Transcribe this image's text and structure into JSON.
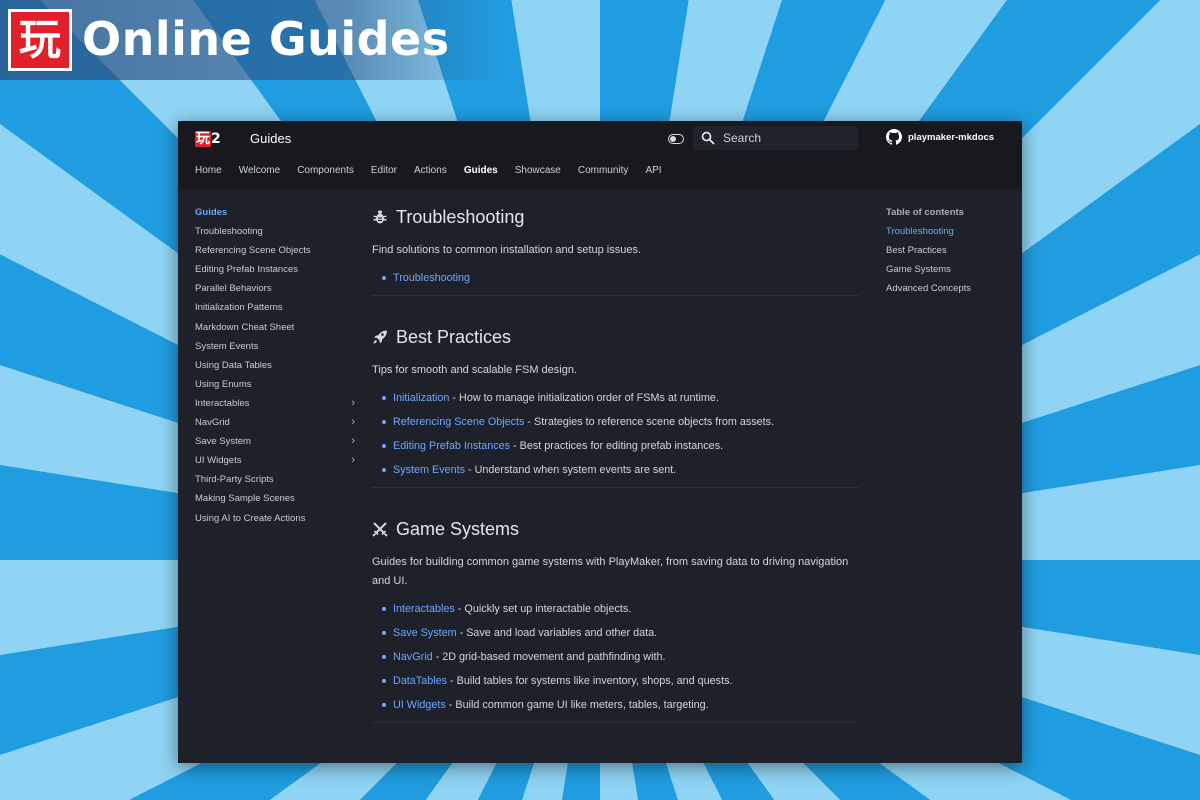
{
  "banner": {
    "logo_char": "玩",
    "title": "Online Guides"
  },
  "header": {
    "logo_char": "玩",
    "logo_num": "2",
    "title": "Guides",
    "search_placeholder": "Search",
    "repo": "playmaker-mkdocs"
  },
  "nav": {
    "items": [
      "Home",
      "Welcome",
      "Components",
      "Editor",
      "Actions",
      "Guides",
      "Showcase",
      "Community",
      "API"
    ],
    "active": "Guides"
  },
  "sidebar": {
    "items": [
      {
        "label": "Guides",
        "active": true,
        "expandable": false
      },
      {
        "label": "Troubleshooting",
        "expandable": false
      },
      {
        "label": "Referencing Scene Objects",
        "expandable": false
      },
      {
        "label": "Editing Prefab Instances",
        "expandable": false
      },
      {
        "label": "Parallel Behaviors",
        "expandable": false
      },
      {
        "label": "Initialization Patterns",
        "expandable": false
      },
      {
        "label": "Markdown Cheat Sheet",
        "expandable": false
      },
      {
        "label": "System Events",
        "expandable": false
      },
      {
        "label": "Using Data Tables",
        "expandable": false
      },
      {
        "label": "Using Enums",
        "expandable": false
      },
      {
        "label": "Interactables",
        "expandable": true
      },
      {
        "label": "NavGrid",
        "expandable": true
      },
      {
        "label": "Save System",
        "expandable": true
      },
      {
        "label": "UI Widgets",
        "expandable": true
      },
      {
        "label": "Third-Party Scripts",
        "expandable": false
      },
      {
        "label": "Making Sample Scenes",
        "expandable": false
      },
      {
        "label": "Using AI to Create Actions",
        "expandable": false
      }
    ]
  },
  "sections": [
    {
      "icon": "bug-icon",
      "title": "Troubleshooting",
      "desc": "Find solutions to common installation and setup issues.",
      "links": [
        {
          "link": "Troubleshooting",
          "text": ""
        }
      ]
    },
    {
      "icon": "rocket-icon",
      "title": "Best Practices",
      "desc": "Tips for smooth and scalable FSM design.",
      "links": [
        {
          "link": "Initialization",
          "text": " - How to manage initialization order of FSMs at runtime."
        },
        {
          "link": "Referencing Scene Objects",
          "text": " - Strategies to reference scene objects from assets."
        },
        {
          "link": "Editing Prefab Instances",
          "text": " - Best practices for editing prefab instances."
        },
        {
          "link": "System Events",
          "text": " - Understand when system events are sent."
        }
      ]
    },
    {
      "icon": "crossed-swords-icon",
      "title": "Game Systems",
      "desc": "Guides for building common game systems with PlayMaker, from saving data to driving navigation and UI.",
      "links": [
        {
          "link": "Interactables",
          "text": " - Quickly set up interactable objects."
        },
        {
          "link": "Save System",
          "text": " - Save and load variables and other data."
        },
        {
          "link": "NavGrid",
          "text": " - 2D grid-based movement and pathfinding with."
        },
        {
          "link": "DataTables",
          "text": " - Build tables for systems like inventory, shops, and quests."
        },
        {
          "link": "UI Widgets",
          "text": " - Build common game UI like meters, tables, targeting."
        }
      ]
    }
  ],
  "toc": {
    "title": "Table of contents",
    "items": [
      {
        "label": "Troubleshooting",
        "active": true
      },
      {
        "label": "Best Practices"
      },
      {
        "label": "Game Systems"
      },
      {
        "label": "Advanced Concepts"
      }
    ]
  },
  "colors": {
    "accent": "#6ea6ff",
    "brand_red": "#e0202a",
    "header_bg": "#17191f",
    "page_bg": "#1e2129"
  }
}
